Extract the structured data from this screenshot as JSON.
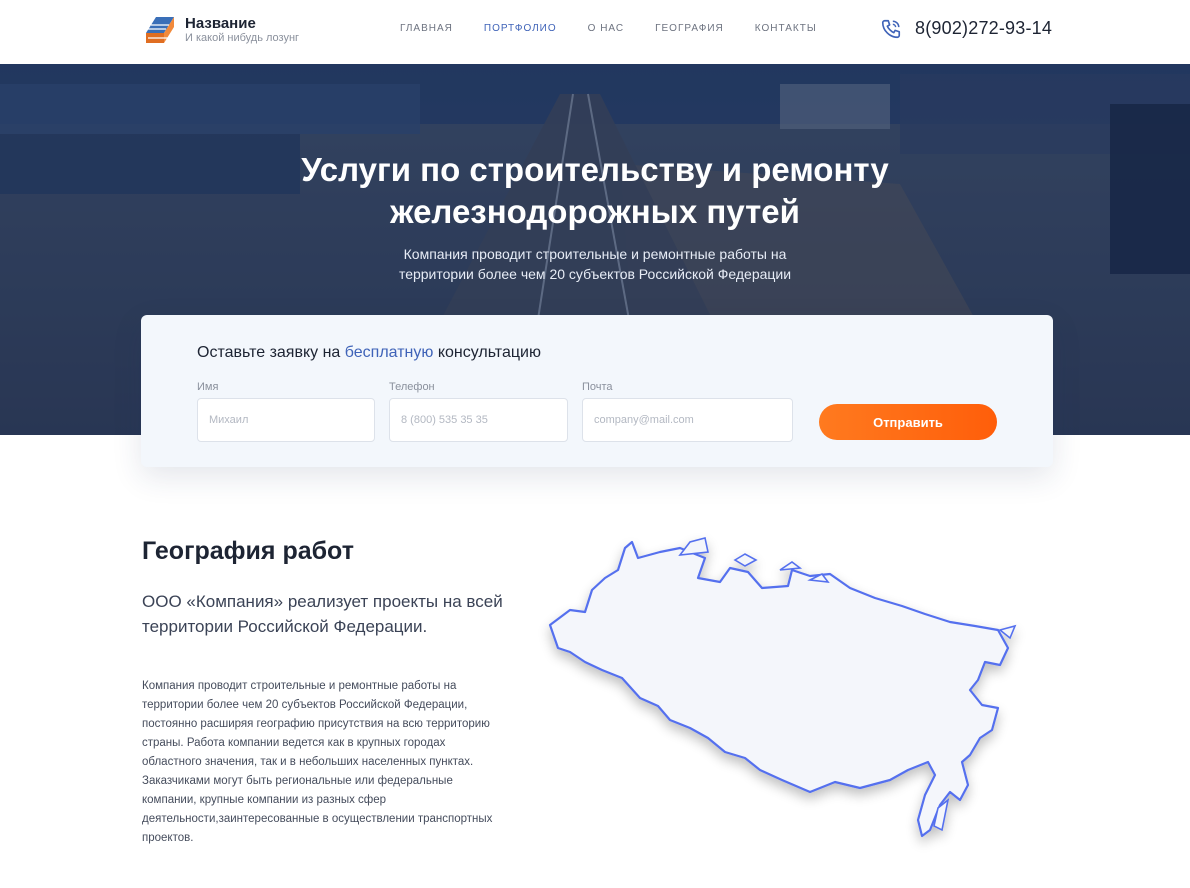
{
  "header": {
    "brand_name": "Название",
    "brand_slogan": "И какой нибудь лозунг",
    "nav": [
      "ГЛАВНАЯ",
      "ПОРТФОЛИО",
      "О НАС",
      "ГЕОГРАФИЯ",
      "КОНТАКТЫ"
    ],
    "active_nav": "ПОРТФОЛИО",
    "phone": "8(902)272-93-14",
    "phone_icon": "phone-icon"
  },
  "hero": {
    "title_line1": "Услуги по строительству и ремонту",
    "title_line2": "железнодорожных путей",
    "subtitle_line1": "Компания проводит строительные и ремонтные работы на",
    "subtitle_line2": "территории более чем 20 субъектов Российской Федерации"
  },
  "form": {
    "heading_before": "Оставьте заявку на ",
    "heading_highlight": "бесплатную",
    "heading_after": " консультацию",
    "fields": [
      {
        "label": "Имя",
        "placeholder": "Михаил"
      },
      {
        "label": "Телефон",
        "placeholder": "8 (800) 535 35 35"
      },
      {
        "label": "Почта",
        "placeholder": "company@mail.com"
      }
    ],
    "submit_label": "Отправить",
    "accent_color": "#ff6a10"
  },
  "geo": {
    "title": "География работ",
    "lead": "ООО «Компания» реализует проекты на всей территории Российской Федерации.",
    "body": "Компания проводит строительные и ремонтные работы на территории более чем 20 субъектов Российской Федерации, постоянно расширяя географию присутствия на всю территорию страны. Работа компании ведется как в крупных городах областного значения, так и в небольших населенных пунктах. Заказчиками могут быть региональные или федеральные компании, крупные компании из разных сфер деятельности,заинтересованные в осуществлении транспортных проектов."
  },
  "colors": {
    "brand_blue": "#3f63b8",
    "dark_text": "#1d2433",
    "hero_dark": "#233a5f"
  }
}
